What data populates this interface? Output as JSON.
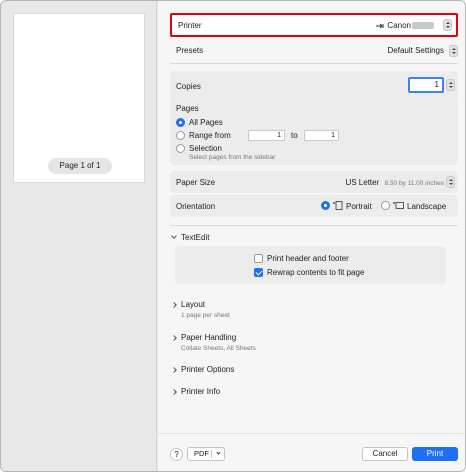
{
  "preview": {
    "page_label": "Page 1 of 1"
  },
  "printer": {
    "label": "Printer",
    "value": "Canon"
  },
  "presets": {
    "label": "Presets",
    "value": "Default Settings"
  },
  "copies": {
    "label": "Copies",
    "value": "1"
  },
  "pages": {
    "label": "Pages",
    "all_pages": "All Pages",
    "range_from": "Range from",
    "range_start": "1",
    "range_to": "to",
    "range_end": "1",
    "selection": "Selection",
    "selection_hint": "Select pages from the sidebar",
    "selected": "All Pages"
  },
  "paper_size": {
    "label": "Paper Size",
    "value": "US Letter",
    "dims": "8.50 by 11.00 inches"
  },
  "orientation": {
    "label": "Orientation",
    "portrait": "Portrait",
    "landscape": "Landscape",
    "selected": "Portrait"
  },
  "textedit": {
    "label": "TextEdit",
    "print_header_footer": "Print header and footer",
    "print_header_footer_checked": false,
    "rewrap": "Rewrap contents to fit page",
    "rewrap_checked": true
  },
  "sections": {
    "layout": "Layout",
    "layout_sub": "1 page per sheet",
    "paper_handling": "Paper Handling",
    "paper_handling_sub": "Collate Sheets, All Sheets",
    "printer_options": "Printer Options",
    "printer_info": "Printer Info"
  },
  "footer": {
    "help": "?",
    "pdf": "PDF",
    "cancel": "Cancel",
    "print": "Print"
  },
  "colors": {
    "accent": "#1e6ff2",
    "highlight": "#e0000f"
  }
}
